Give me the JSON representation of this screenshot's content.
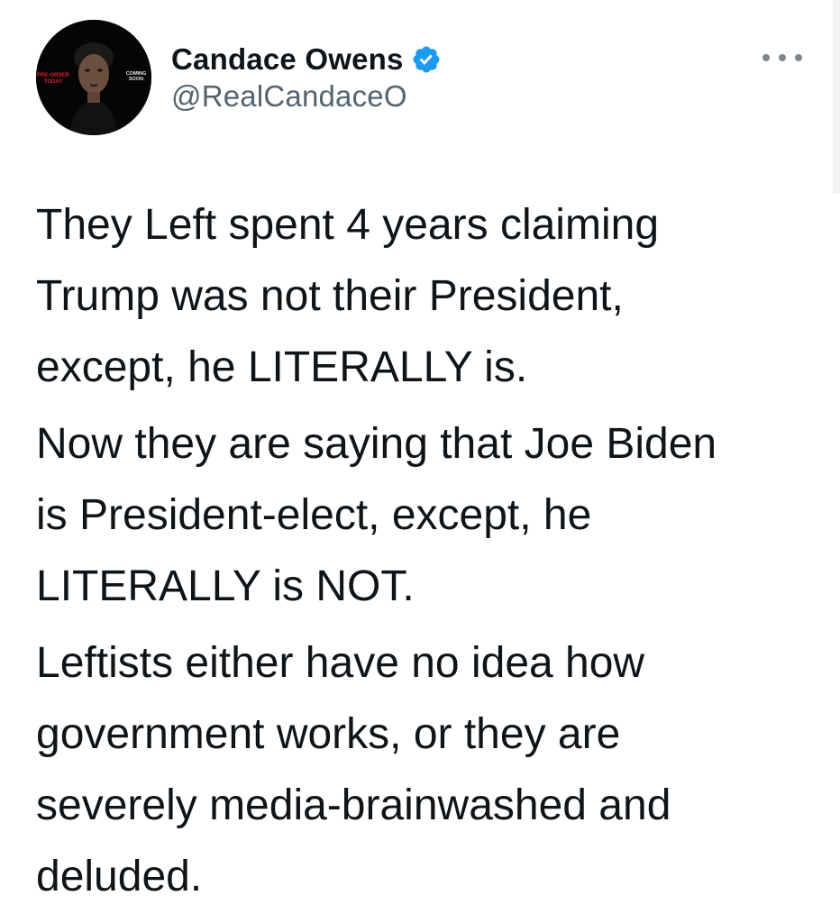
{
  "tweet": {
    "author": {
      "name": "Candace Owens",
      "handle": "@RealCandaceO",
      "verified": true,
      "avatar_text_left": "PRE-ORDER\nTODAY",
      "avatar_text_right": "COMING\nSOON"
    },
    "more_icon": "more-horizontal-icon",
    "paragraphs": [
      "They Left spent 4 years claiming\nTrump was not their President,\nexcept, he LITERALLY is.",
      "Now they are saying that Joe Biden\nis President-elect, except, he\nLITERALLY is NOT.",
      "Leftists either have no idea how\ngovernment works, or they are\nseverely media-brainwashed and\ndeluded."
    ]
  },
  "colors": {
    "text": "#0f1419",
    "secondary": "#536471",
    "verified": "#1d9bf0",
    "avatar_accent": "#d01f2e"
  }
}
